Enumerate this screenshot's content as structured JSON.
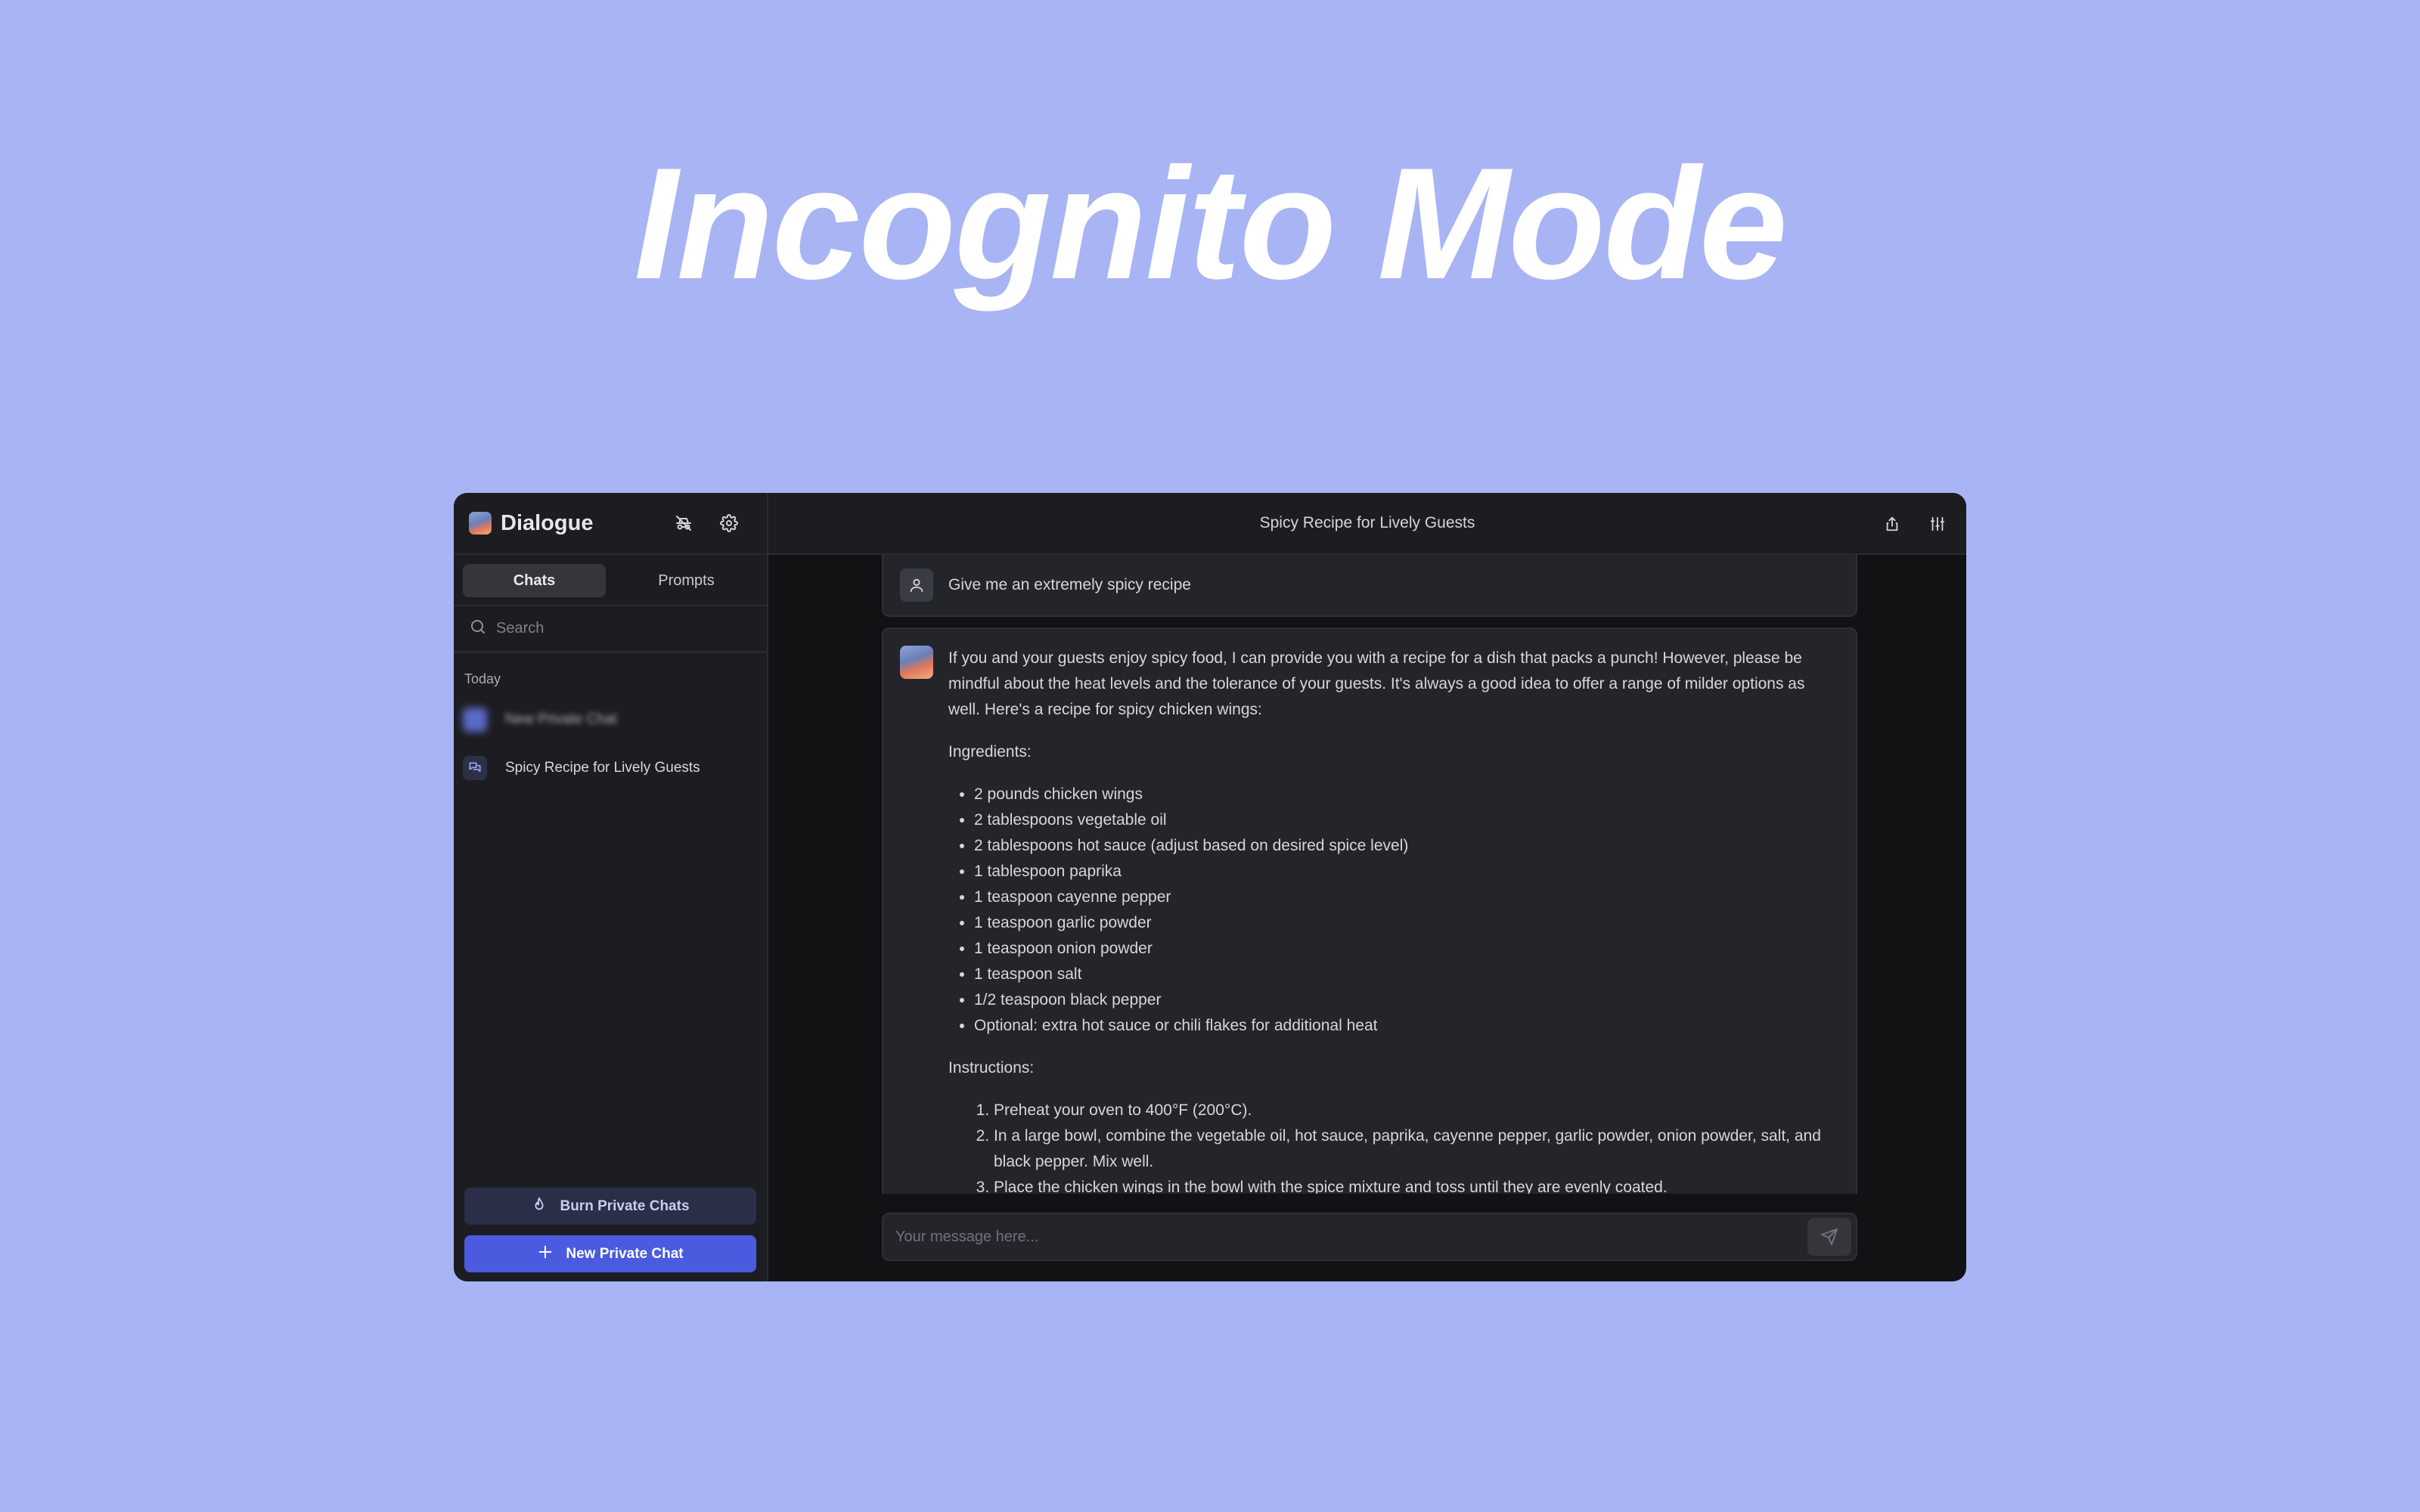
{
  "hero": {
    "title": "Incognito Mode"
  },
  "app": {
    "name": "Dialogue"
  },
  "sidebar": {
    "tabs": [
      {
        "label": "Chats",
        "active": true
      },
      {
        "label": "Prompts",
        "active": false
      }
    ],
    "search": {
      "placeholder": "Search"
    },
    "section_label": "Today",
    "chats": [
      {
        "label": "New Private Chat",
        "blurred": true
      },
      {
        "label": "Spicy Recipe for Lively Guests",
        "blurred": false
      }
    ],
    "burn_button": "Burn Private Chats",
    "new_button": "New Private Chat"
  },
  "main": {
    "title": "Spicy Recipe for Lively Guests",
    "user_message": "Give me an extremely spicy recipe",
    "bot": {
      "intro": "If you and your guests enjoy spicy food, I can provide you with a recipe for a dish that packs a punch! However, please be mindful about the heat levels and the tolerance of your guests. It's always a good idea to offer a range of milder options as well. Here's a recipe for spicy chicken wings:",
      "ingredients_heading": "Ingredients:",
      "ingredients": [
        "2 pounds chicken wings",
        "2 tablespoons vegetable oil",
        "2 tablespoons hot sauce (adjust based on desired spice level)",
        "1 tablespoon paprika",
        "1 teaspoon cayenne pepper",
        "1 teaspoon garlic powder",
        "1 teaspoon onion powder",
        "1 teaspoon salt",
        "1/2 teaspoon black pepper",
        "Optional: extra hot sauce or chili flakes for additional heat"
      ],
      "instructions_heading": "Instructions:",
      "instructions": [
        "Preheat your oven to 400°F (200°C).",
        "In a large bowl, combine the vegetable oil, hot sauce, paprika, cayenne pepper, garlic powder, onion powder, salt, and black pepper. Mix well.",
        "Place the chicken wings in the bowl with the spice mixture and toss until they are evenly coated."
      ]
    },
    "composer": {
      "placeholder": "Your message here..."
    }
  },
  "colors": {
    "background": "#a8b4f4",
    "accent": "#4a5be0",
    "sidebar": "#1c1d21",
    "message": "#24252b"
  }
}
